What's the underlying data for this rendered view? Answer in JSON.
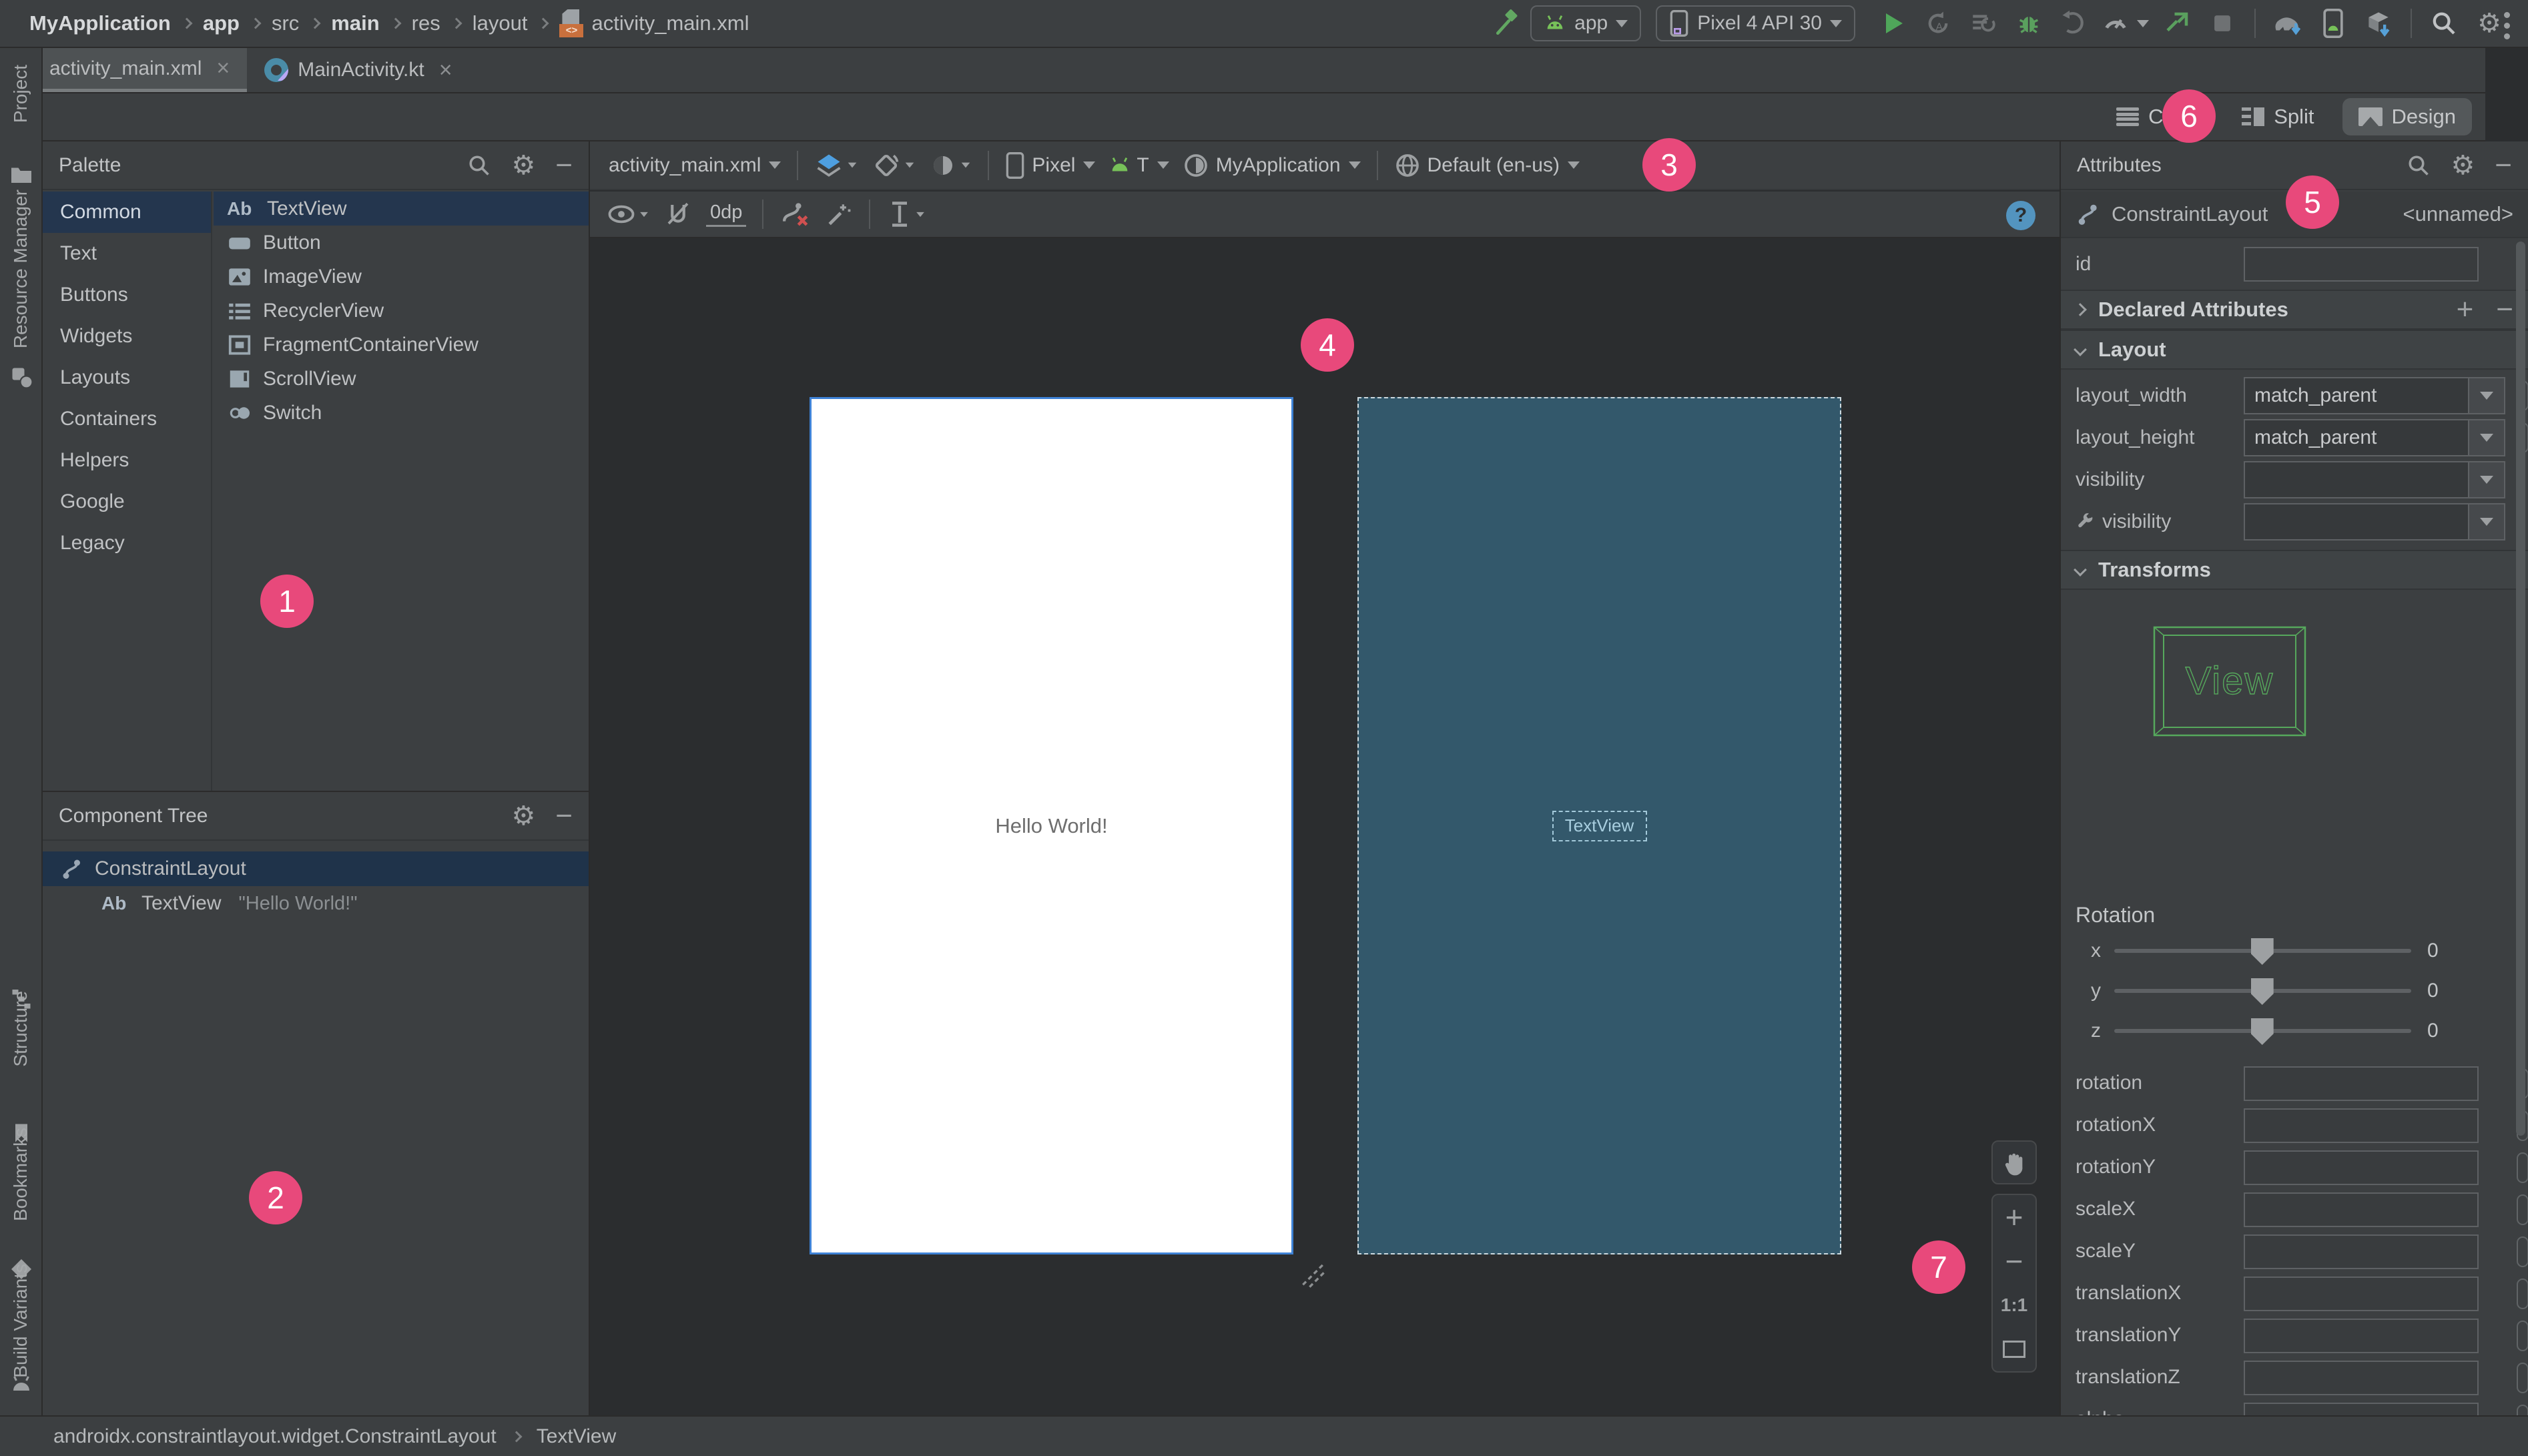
{
  "toolbar": {
    "breadcrumbs": [
      "MyApplication",
      "app",
      "src",
      "main",
      "res",
      "layout",
      "activity_main.xml"
    ],
    "run_config": "app",
    "device": "Pixel 4 API 30"
  },
  "tabs": [
    {
      "label": "activity_main.xml",
      "close": "×"
    },
    {
      "label": "MainActivity.kt",
      "close": "×"
    }
  ],
  "view_modes": {
    "code": "Code",
    "split": "Split",
    "design": "Design",
    "selected": "Design"
  },
  "gutter": {
    "project": "Project",
    "resource_manager": "Resource Manager",
    "structure": "Structure",
    "bookmarks": "Bookmarks",
    "build_variants": "Build Variants"
  },
  "palette": {
    "title": "Palette",
    "categories": [
      "Common",
      "Text",
      "Buttons",
      "Widgets",
      "Layouts",
      "Containers",
      "Helpers",
      "Google",
      "Legacy"
    ],
    "selected_category": "Common",
    "items": [
      "TextView",
      "Button",
      "ImageView",
      "RecyclerView",
      "FragmentContainerView",
      "ScrollView",
      "Switch"
    ],
    "selected_item": "TextView"
  },
  "design_toolbar": {
    "file": "activity_main.xml",
    "device": "Pixel",
    "api": "T",
    "theme": "MyApplication",
    "locale": "Default (en-us)",
    "margin": "0dp",
    "help": "?"
  },
  "canvas": {
    "design_text": "Hello World!",
    "blueprint_text": "TextView",
    "zoom_in": "+",
    "zoom_out": "−",
    "zoom_reset": "1:1"
  },
  "component_tree": {
    "title": "Component Tree",
    "items": [
      {
        "label": "ConstraintLayout",
        "detail": ""
      },
      {
        "label": "TextView",
        "detail": "\"Hello World!\""
      }
    ]
  },
  "attributes": {
    "title": "Attributes",
    "component": "ConstraintLayout",
    "component_id": "<unnamed>",
    "id_label": "id",
    "id_value": "",
    "declared_header": "Declared Attributes",
    "layout_header": "Layout",
    "transforms_header": "Transforms",
    "layout_rows": [
      {
        "label": "layout_width",
        "value": "match_parent"
      },
      {
        "label": "layout_height",
        "value": "match_parent"
      },
      {
        "label": "visibility",
        "value": ""
      },
      {
        "label": "visibility",
        "value": ""
      }
    ],
    "transforms": {
      "view_label": "View",
      "rotation_label": "Rotation",
      "sliders": [
        {
          "axis": "x",
          "value": "0"
        },
        {
          "axis": "y",
          "value": "0"
        },
        {
          "axis": "z",
          "value": "0"
        }
      ]
    },
    "fields": [
      "rotation",
      "rotationX",
      "rotationY",
      "scaleX",
      "scaleY",
      "translationX",
      "translationY",
      "translationZ",
      "alpha"
    ]
  },
  "status_bar": {
    "class_name": "androidx.constraintlayout.widget.ConstraintLayout",
    "selection": "TextView"
  },
  "icons": {
    "ab": "Ab"
  },
  "badges": [
    "1",
    "2",
    "3",
    "4",
    "5",
    "6",
    "7"
  ],
  "colors": {
    "accent_pink": "#e8497b",
    "selection_blue": "#24364e",
    "blueprint_fill": "#33586b",
    "phone_border": "#3e82d6",
    "wireframe_green": "#56a85c"
  }
}
